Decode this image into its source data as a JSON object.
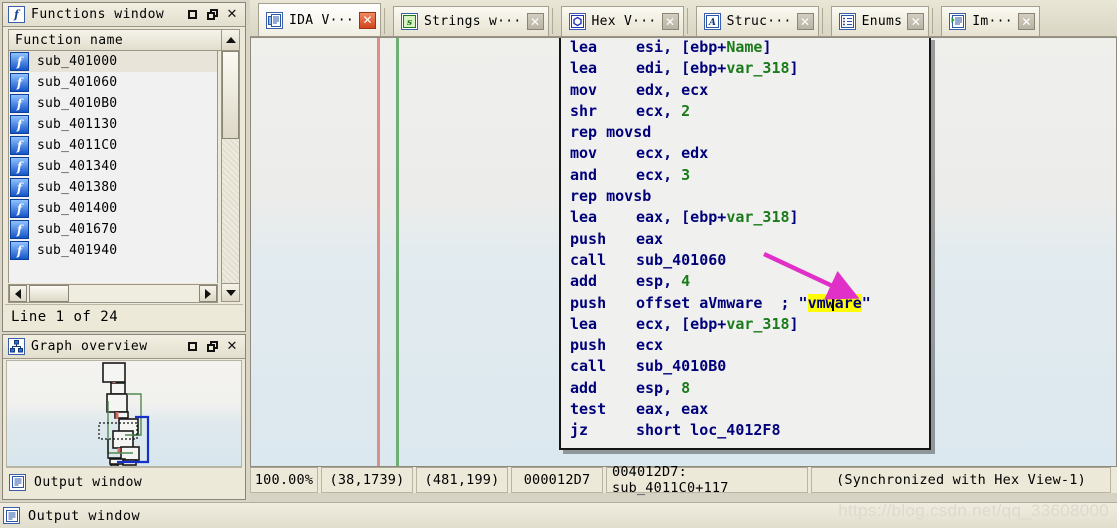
{
  "functions_window": {
    "title": "Functions window",
    "icon": "function-icon",
    "buttons": {
      "minimize": "minimize",
      "restore": "restore",
      "close": "close"
    },
    "column_header": "Function name",
    "items": [
      {
        "icon": "f",
        "name": "sub_401000",
        "selected": true
      },
      {
        "icon": "f",
        "name": "sub_401060",
        "selected": false
      },
      {
        "icon": "f",
        "name": "sub_4010B0",
        "selected": false
      },
      {
        "icon": "f",
        "name": "sub_401130",
        "selected": false
      },
      {
        "icon": "f",
        "name": "sub_4011C0",
        "selected": false
      },
      {
        "icon": "f",
        "name": "sub_401340",
        "selected": false
      },
      {
        "icon": "f",
        "name": "sub_401380",
        "selected": false
      },
      {
        "icon": "f",
        "name": "sub_401400",
        "selected": false
      },
      {
        "icon": "f",
        "name": "sub_401670",
        "selected": false
      },
      {
        "icon": "f",
        "name": "sub_401940",
        "selected": false
      }
    ],
    "status": "Line 1 of 24"
  },
  "graph_overview": {
    "title": "Graph overview",
    "icon": "graph-icon"
  },
  "output_window": {
    "title": "Output window",
    "icon": "output-icon"
  },
  "tabs": [
    {
      "label": "IDA V···",
      "icon": "ida-view-icon",
      "active": true,
      "close": "✕",
      "close_hot": true
    },
    {
      "label": "Strings w···",
      "icon": "strings-icon",
      "active": false,
      "close": "✕",
      "close_hot": false
    },
    {
      "label": "Hex V···",
      "icon": "hex-view-icon",
      "active": false,
      "close": "✕",
      "close_hot": false
    },
    {
      "label": "Struc···",
      "icon": "structures-icon",
      "active": false,
      "close": "✕",
      "close_hot": false
    },
    {
      "label": "Enums",
      "icon": "enums-icon",
      "active": false,
      "close": "✕",
      "close_hot": false
    },
    {
      "label": "Im···",
      "icon": "imports-icon",
      "active": false,
      "close": "✕",
      "close_hot": false
    }
  ],
  "disassembly": {
    "lines": [
      {
        "mnemonic": "lea",
        "operands": "esi, [ebp+",
        "var": "Name",
        "tail": "]"
      },
      {
        "mnemonic": "lea",
        "operands": "edi, [ebp+",
        "var": "var_318",
        "tail": "]"
      },
      {
        "mnemonic": "mov",
        "operands": "edx, ecx",
        "var": "",
        "tail": ""
      },
      {
        "mnemonic": "shr",
        "operands": "ecx, ",
        "num": "2",
        "tail": ""
      },
      {
        "mnemonic": "rep movsd",
        "operands": "",
        "var": "",
        "tail": ""
      },
      {
        "mnemonic": "mov",
        "operands": "ecx, edx",
        "var": "",
        "tail": ""
      },
      {
        "mnemonic": "and",
        "operands": "ecx, ",
        "num": "3",
        "tail": ""
      },
      {
        "mnemonic": "rep movsb",
        "operands": "",
        "var": "",
        "tail": ""
      },
      {
        "mnemonic": "lea",
        "operands": "eax, [ebp+",
        "var": "var_318",
        "tail": "]"
      },
      {
        "mnemonic": "push",
        "operands": "eax",
        "var": "",
        "tail": ""
      },
      {
        "mnemonic": "call",
        "operands": "sub_401060",
        "var": "",
        "tail": ""
      },
      {
        "mnemonic": "add",
        "operands": "esp, ",
        "num": "4",
        "tail": ""
      },
      {
        "mnemonic": "push",
        "operands": "offset aVmware",
        "comment": ";",
        "string": "vmware",
        "highlighted": true,
        "tail": ""
      },
      {
        "mnemonic": "lea",
        "operands": "ecx, [ebp+",
        "var": "var_318",
        "tail": "]"
      },
      {
        "mnemonic": "push",
        "operands": "ecx",
        "var": "",
        "tail": ""
      },
      {
        "mnemonic": "call",
        "operands": "sub_4010B0",
        "var": "",
        "tail": ""
      },
      {
        "mnemonic": "add",
        "operands": "esp, ",
        "num": "8",
        "tail": ""
      },
      {
        "mnemonic": "test",
        "operands": "eax, eax",
        "var": "",
        "tail": ""
      },
      {
        "mnemonic": "jz",
        "operands": "short loc_4012F8",
        "var": "",
        "tail": ""
      }
    ],
    "highlight_color": "#ffff00",
    "annotation_arrow_color": "#e030c8"
  },
  "status_bar": {
    "zoom": "100.00%",
    "graph_coords": "(38,1739)",
    "view_coords": "(481,199)",
    "file_offset": "000012D7",
    "address": "004012D7: sub_4011C0+117",
    "sync": "(Synchronized with Hex View-1)"
  },
  "watermark": "https://blog.csdn.net/qq_33608000"
}
